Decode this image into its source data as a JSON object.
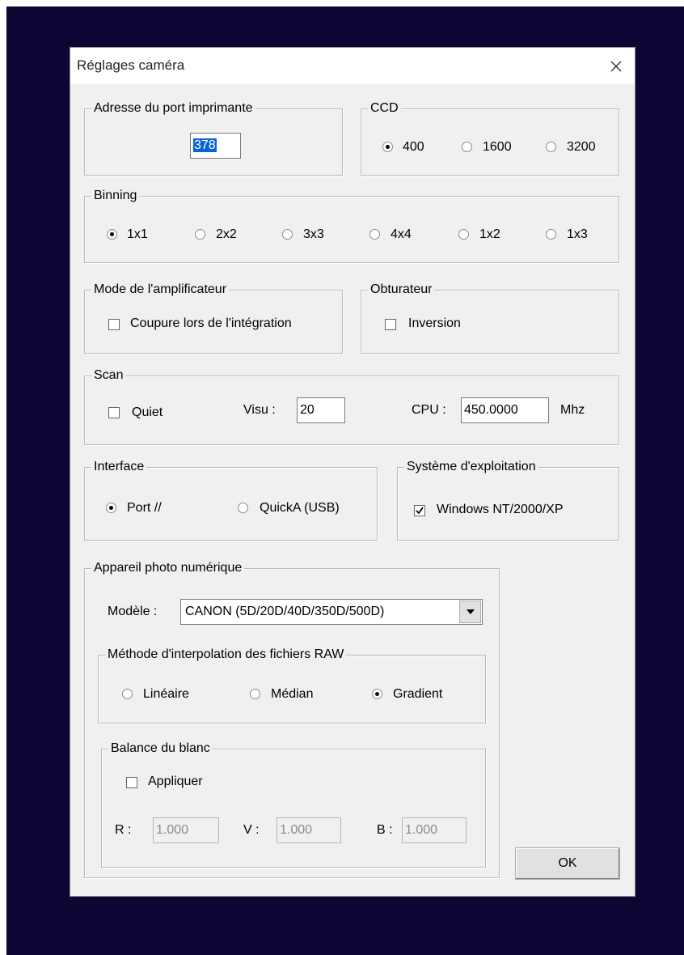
{
  "window": {
    "title": "Réglages caméra"
  },
  "printer_port": {
    "legend": "Adresse du port imprimante",
    "value": "378"
  },
  "ccd": {
    "legend": "CCD",
    "options": [
      "400",
      "1600",
      "3200"
    ],
    "selected": "400"
  },
  "binning": {
    "legend": "Binning",
    "options": [
      "1x1",
      "2x2",
      "3x3",
      "4x4",
      "1x2",
      "1x3"
    ],
    "selected": "1x1"
  },
  "amplifier": {
    "legend": "Mode de l'amplificateur",
    "checkbox_label": "Coupure lors de l'intégration",
    "checked": false
  },
  "shutter": {
    "legend": "Obturateur",
    "checkbox_label": "Inversion",
    "checked": false
  },
  "scan": {
    "legend": "Scan",
    "quiet_label": "Quiet",
    "quiet_checked": false,
    "visu_label": "Visu :",
    "visu_value": "20",
    "cpu_label": "CPU :",
    "cpu_value": "450.0000",
    "cpu_unit": "Mhz"
  },
  "interface": {
    "legend": "Interface",
    "options": [
      "Port //",
      "QuickA (USB)"
    ],
    "selected": "Port //"
  },
  "os": {
    "legend": "Système d'exploitation",
    "checkbox_label": "Windows NT/2000/XP",
    "checked": true
  },
  "camera": {
    "legend": "Appareil photo numérique",
    "model_label": "Modèle :",
    "model_value": "CANON (5D/20D/40D/350D/500D)",
    "interpolation": {
      "legend": "Méthode d'interpolation des fichiers RAW",
      "options": [
        "Linéaire",
        "Médian",
        "Gradient"
      ],
      "selected": "Gradient"
    },
    "white_balance": {
      "legend": "Balance du blanc",
      "apply_label": "Appliquer",
      "apply_checked": false,
      "r_label": "R :",
      "r_value": "1.000",
      "v_label": "V :",
      "v_value": "1.000",
      "b_label": "B :",
      "b_value": "1.000"
    }
  },
  "ok_label": "OK"
}
